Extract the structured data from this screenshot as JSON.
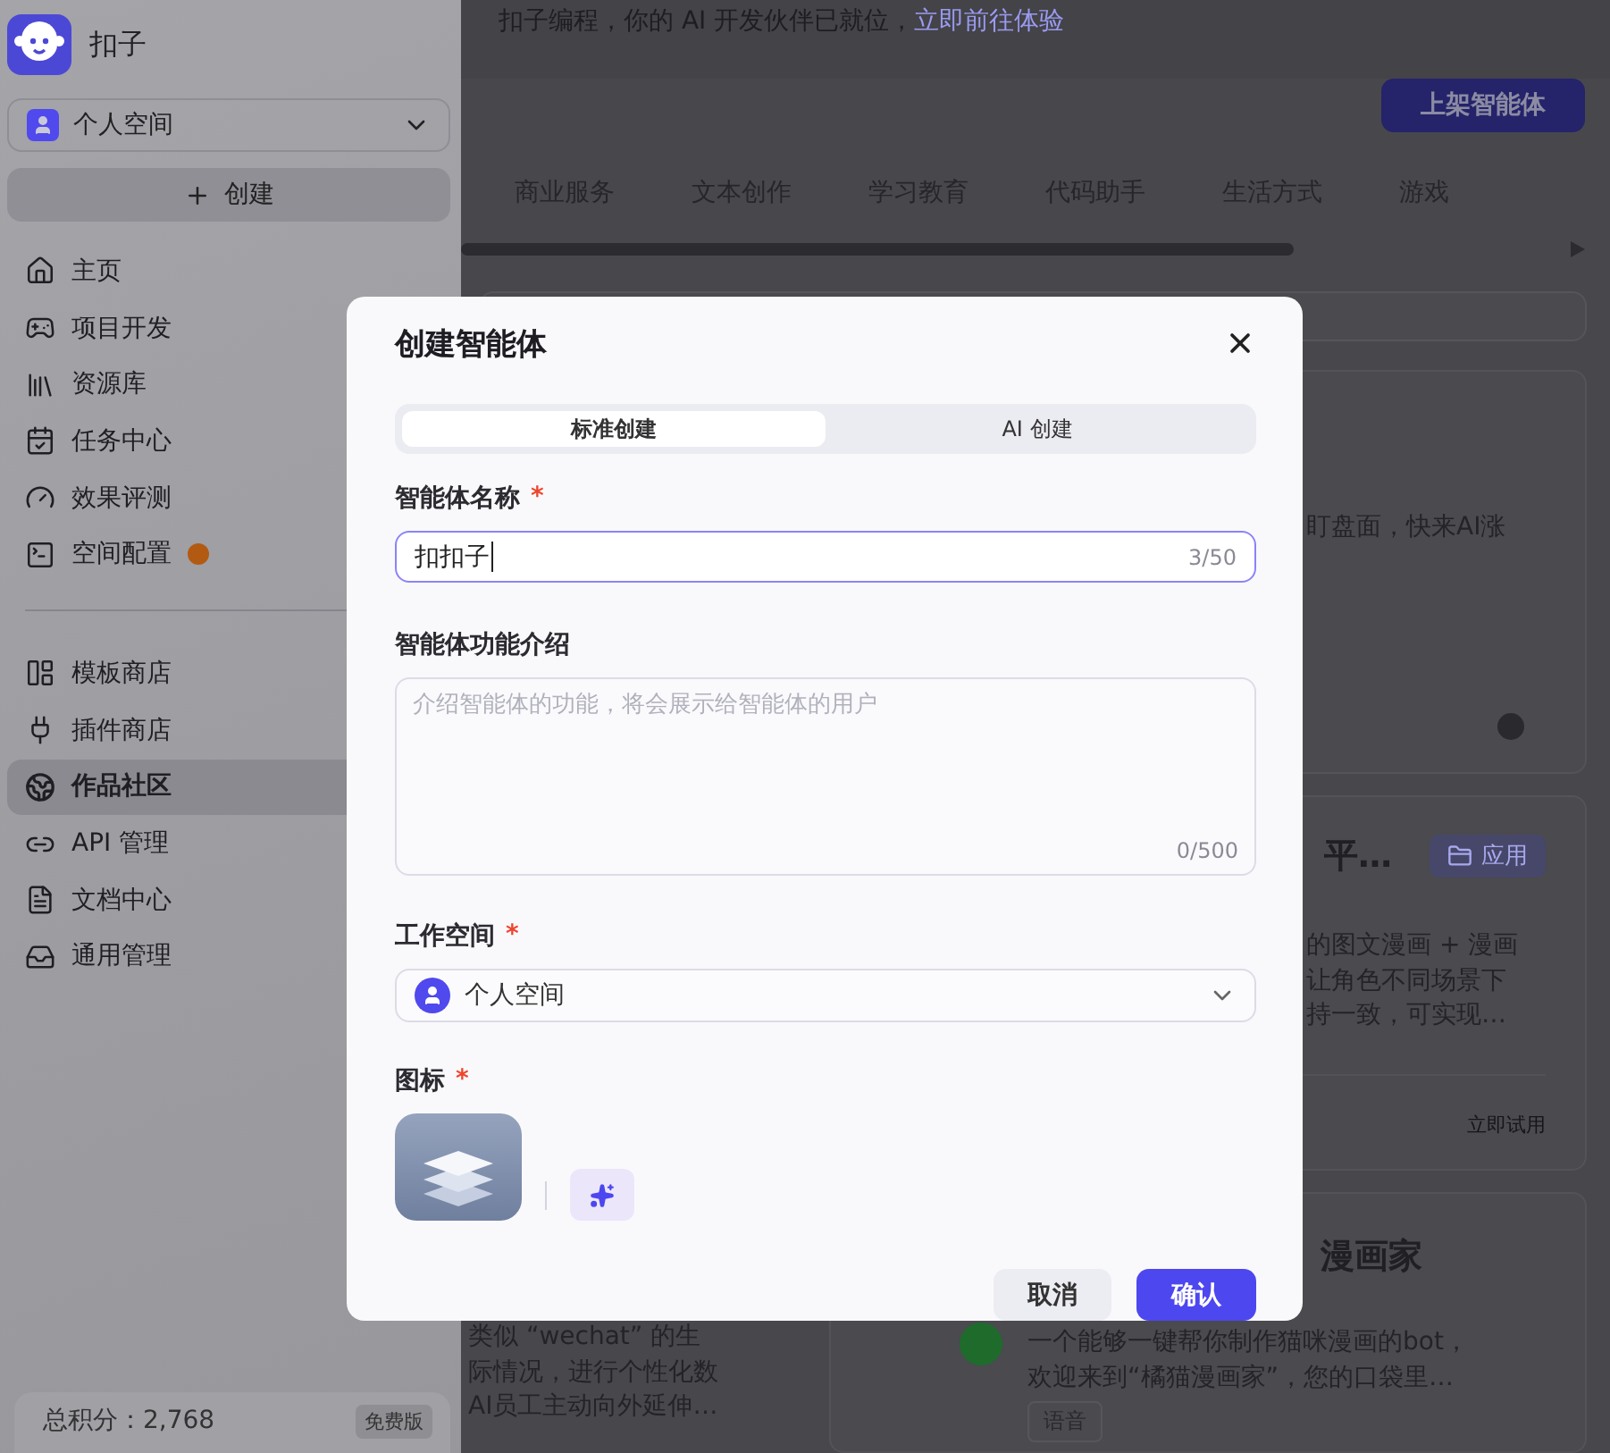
{
  "sidebar": {
    "brand": "扣子",
    "workspace": "个人空间",
    "create": "创建",
    "nav_groups": [
      [
        {
          "label": "主页",
          "selected": false,
          "alert": false
        },
        {
          "label": "项目开发",
          "selected": false,
          "alert": false
        },
        {
          "label": "资源库",
          "selected": false,
          "alert": false
        },
        {
          "label": "任务中心",
          "selected": false,
          "alert": false
        },
        {
          "label": "效果评测",
          "selected": false,
          "alert": false
        },
        {
          "label": "空间配置",
          "selected": false,
          "alert": true
        }
      ],
      [
        {
          "label": "模板商店",
          "selected": false,
          "alert": false
        },
        {
          "label": "插件商店",
          "selected": false,
          "alert": false
        },
        {
          "label": "作品社区",
          "selected": true,
          "alert": false
        },
        {
          "label": "API 管理",
          "selected": false,
          "alert": false
        },
        {
          "label": "文档中心",
          "selected": false,
          "alert": false
        },
        {
          "label": "通用管理",
          "selected": false,
          "alert": false
        }
      ]
    ],
    "footer": {
      "points": "总积分：2,768",
      "plan": "免费版"
    }
  },
  "main": {
    "banner": {
      "text": "扣子编程，你的 AI 开发伙伴已就位，",
      "link": "立即前往体验"
    },
    "publish_button": "上架智能体",
    "categories": [
      {
        "label": "商业服务",
        "selected": false
      },
      {
        "label": "文本创作",
        "selected": false
      },
      {
        "label": "学习教育",
        "selected": false
      },
      {
        "label": "代码助手",
        "selected": false
      },
      {
        "label": "生活方式",
        "selected": false
      },
      {
        "label": "游戏",
        "selected": false
      }
    ],
    "cards": [
      {
        "lines": [
          "盯盘面，快来AI涨"
        ]
      },
      {
        "title": "平…",
        "tag": "应用",
        "lines": [
          "的图文漫画 + 漫画",
          "让角色不同场景下",
          "持一致，可实现…"
        ],
        "action": "立即试用"
      },
      {
        "lines": [
          "类似 “wechat” 的生",
          "际情况，进行个性化数",
          "AI员工主动向外延伸…"
        ]
      },
      {
        "title": "漫画家",
        "lines": [
          "一个能够一键帮你制作猫咪漫画的bot，",
          "欢迎来到“橘猫漫画家”，您的口袋里…"
        ],
        "tag": "语音"
      }
    ]
  },
  "modal": {
    "title": "创建智能体",
    "tabs": [
      {
        "label": "标准创建",
        "selected": true
      },
      {
        "label": "AI 创建",
        "selected": false
      }
    ],
    "name_field": {
      "label": "智能体名称",
      "required_mark": "*",
      "value": "扣扣子",
      "counter": "3/50",
      "focused": true
    },
    "description_field": {
      "label": "智能体功能介绍",
      "placeholder": "介绍智能体的功能，将会展示给智能体的用户",
      "counter": "0/500",
      "focused": false
    },
    "workspace_field": {
      "label": "工作空间",
      "required_mark": "*",
      "value": "个人空间"
    },
    "icon_field": {
      "label": "图标",
      "required_mark": "*"
    },
    "buttons": [
      {
        "kind": "cancel",
        "label": "取消"
      },
      {
        "kind": "confirm",
        "label": "确认"
      }
    ]
  }
}
